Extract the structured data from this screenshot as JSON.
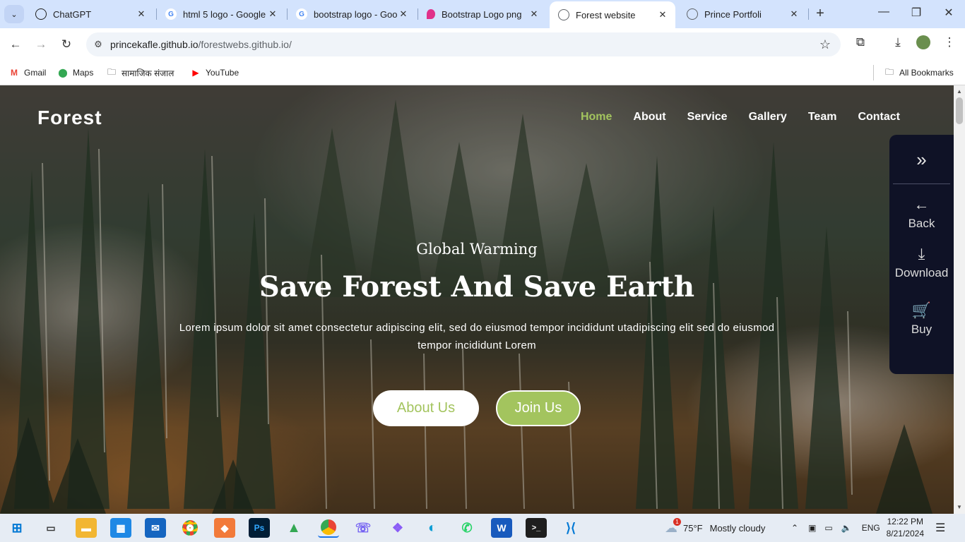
{
  "browser": {
    "tabs": [
      {
        "title": "ChatGPT",
        "icon": "chatgpt-icon",
        "color": "#1f1f1f"
      },
      {
        "title": "html 5 logo - Google",
        "icon": "google-icon",
        "color": "#4285f4"
      },
      {
        "title": "bootstrap logo - Goo",
        "icon": "google-icon",
        "color": "#4285f4"
      },
      {
        "title": "Bootstrap Logo png",
        "icon": "pngwing-icon",
        "color": "#e0318a"
      },
      {
        "title": "Forest website",
        "icon": "globe-icon",
        "color": "#5f6368"
      },
      {
        "title": "Prince Portfoli",
        "icon": "globe-icon",
        "color": "#5f6368"
      }
    ],
    "url_host": "princekafle.github.io",
    "url_path": "/forestwebs.github.io/",
    "bookmarks": [
      {
        "label": "Gmail",
        "icon": "gmail-icon"
      },
      {
        "label": "Maps",
        "icon": "maps-icon"
      },
      {
        "label": "सामाजिक संजाल",
        "icon": "folder-icon"
      },
      {
        "label": "YouTube",
        "icon": "youtube-icon"
      }
    ],
    "all_bookmarks": "All Bookmarks"
  },
  "site": {
    "logo": "Forest",
    "nav": [
      "Home",
      "About",
      "Service",
      "Gallery",
      "Team",
      "Contact"
    ],
    "active_nav": "Home",
    "hero_sub": "Global Warming",
    "hero_title": "Save Forest And Save Earth",
    "hero_text": "Lorem ipsum dolor sit amet consectetur adipiscing elit, sed do eiusmod tempor incididunt utadipiscing elit sed do eiusmod tempor incididunt Lorem",
    "btn_about": "About Us",
    "btn_join": "Join Us",
    "accent": "#a3c45e"
  },
  "side_panel": {
    "toggle_icon": "double-chevron-right-icon",
    "items": [
      {
        "label": "Back",
        "icon": "arrow-left-icon"
      },
      {
        "label": "Download",
        "icon": "download-icon"
      },
      {
        "label": "Buy",
        "icon": "cart-icon"
      }
    ]
  },
  "taskbar": {
    "weather_temp": "75°F",
    "weather_text": "Mostly cloudy",
    "weather_badge": "1",
    "language": "ENG",
    "time": "12:22 PM",
    "date": "8/21/2024"
  }
}
